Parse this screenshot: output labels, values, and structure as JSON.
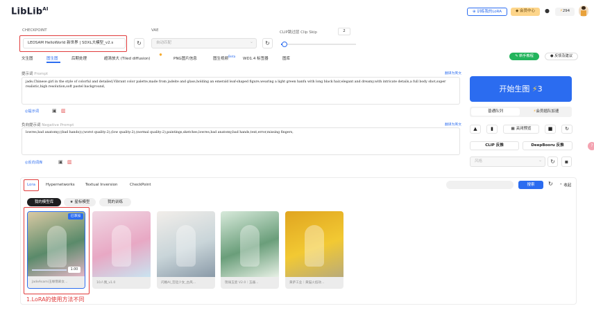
{
  "header": {
    "logo_text": "LibLib",
    "logo_sup": "AI",
    "lora_btn": "训练我的LoRA",
    "member_btn": "会员中心",
    "points": "294",
    "colors": {
      "brand": "#2b6cf0",
      "member_bg": "#fdd58a"
    }
  },
  "checkpoint": {
    "label": "CHECKPOINT",
    "value": "LEOSAM HelloWorld 新世界 | SDXL大模型_v2.s",
    "vae_label": "VAE",
    "vae_value": "自动匹配",
    "clip_label": "CLIP跳过层 Clip Skip",
    "clip_value": "2",
    "clip_level": 0.05
  },
  "tabs": [
    "文生图",
    "图生图",
    "后期处理",
    "超清放大 (Tiled diffusion)",
    "PNG图片信息",
    "图生视频",
    "WD1.4 标签器",
    "图库"
  ],
  "tab_badge": "Beta",
  "top_right": {
    "tutorial": "新手教程",
    "feedback": "反馈及建议"
  },
  "prompt": {
    "label": "提示词",
    "label_en": "Prompt",
    "translate": "翻译为英文",
    "text": "jade,Chinese girl in the style of colorful and detailed,Vibrant color palette,made from jadeite and glass,holding an emerald leaf-shaped figure,wearing a light green hanfu with long black hair,elegant and dreamy,with intricate details,a full body shot,super realistic,high resolution,soft pastel background,",
    "helper": "提示词"
  },
  "negative": {
    "label": "负向提示词",
    "label_en": "Negative Prompt",
    "translate": "翻译为英文",
    "text": "lowres,bad anatomy,((bad hands)),(worst quality:2),(low quality:2),(normal quality:2),paintings,sketches,lowres,bad anatomy,bad hands,text,error,missing fingers,",
    "helper": "反向词库"
  },
  "generate": {
    "label": "开始生图",
    "count": "3",
    "queue_normal": "普通队列",
    "queue_vip": "会员插队加速",
    "close_preview": "关闭预览",
    "clip_feedback": "CLIP 反推",
    "deepbooru": "DeepBooru 反推",
    "style_placeholder": "风格"
  },
  "lora_panel": {
    "tabs": [
      "Lora",
      "Hypernetworks",
      "Textual Inversion",
      "CheckPoint"
    ],
    "search_btn": "搜索",
    "collapse": "收起",
    "filters": [
      "我的模型库",
      "星标模型",
      "我的训练"
    ],
    "cards": [
      {
        "caption": "JadeAsami玉缘翡翠女...",
        "badge": "已添加",
        "weight": "1.00",
        "colors": [
          "#d9c9a3",
          "#5a8a6a",
          "#e8b7c9"
        ]
      },
      {
        "caption": "10人偶_v1.0",
        "colors": [
          "#f0d7e3",
          "#e8a8c4",
          "#c9e3f0"
        ]
      },
      {
        "caption": "闪婚AI_宫廷少女_古风...",
        "colors": [
          "#f2eeea",
          "#c9d5d9",
          "#8a9aa8"
        ]
      },
      {
        "caption": "琉璃玉瓷 V2.0｜玉器...",
        "colors": [
          "#d8eadb",
          "#6a9e7a",
          "#e7f0e5"
        ]
      },
      {
        "caption": "黄萨工业｜黄猫火焰效...",
        "colors": [
          "#e0a520",
          "#f2c933",
          "#b9ab7a"
        ]
      }
    ]
  },
  "annotation": "1.LoRA的使用方法不同"
}
